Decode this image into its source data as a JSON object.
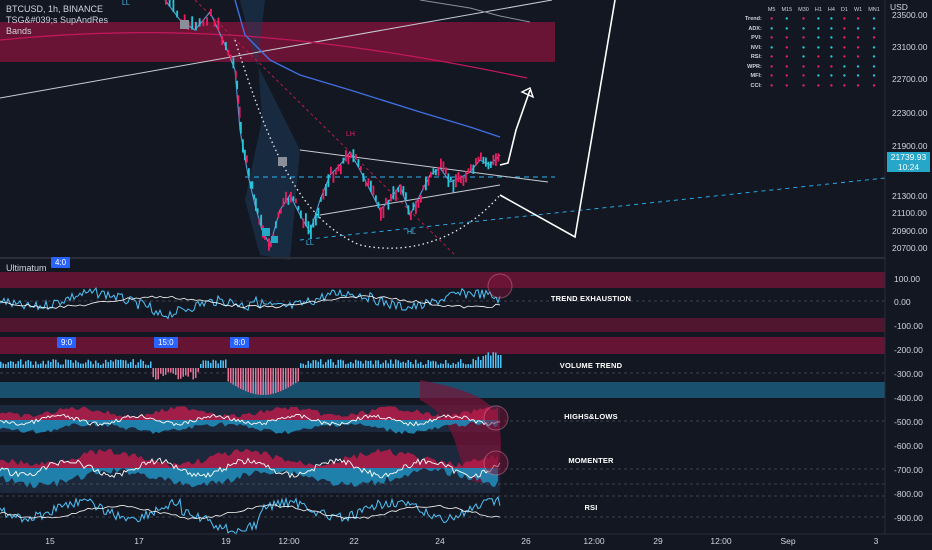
{
  "header": {
    "symbol_line": "BTCUSD, 1h, BINANCE",
    "indicator_line1": "TSG&#039;s SupAndRes",
    "indicator_line2": "Bands",
    "ll_top": "LL"
  },
  "price_axis": {
    "currency": "USD",
    "labels": [
      "23500.00",
      "23100.00",
      "22700.00",
      "22300.00",
      "21900.00",
      "21300.00",
      "21100.00",
      "20900.00",
      "20700.00"
    ],
    "badge_price": "21739.93",
    "badge_time": "10:24"
  },
  "indicator_axis": {
    "labels": [
      "100.00",
      "0.00",
      "-100.00",
      "-200.00",
      "-300.00",
      "-400.00",
      "-500.00",
      "-600.00",
      "-700.00",
      "-800.00",
      "-900.00"
    ]
  },
  "time_axis": {
    "labels": [
      "15",
      "17",
      "19",
      "12:00",
      "22",
      "24",
      "26",
      "12:00",
      "29",
      "12:00",
      "Sep",
      "3"
    ]
  },
  "annotations": {
    "lh": "LH",
    "hl": "HL",
    "ll_bottom": "LL"
  },
  "indicator_pane": {
    "name": "Ultimatum",
    "top_marker": "4:0",
    "markers": [
      "9:0",
      "15:0",
      "8:0"
    ],
    "sections": [
      "TREND EXHAUSTION",
      "VOLUME TREND",
      "HIGHS&LOWS",
      "MOMENTER",
      "RSI"
    ]
  },
  "mtf_table": {
    "columns": [
      "M5",
      "M15",
      "M30",
      "H1",
      "H4",
      "D1",
      "W1",
      "MN1"
    ],
    "rows": [
      {
        "label": "Trend:",
        "cells": [
          "r",
          "g",
          "r",
          "g",
          "g",
          "r",
          "r",
          "g"
        ]
      },
      {
        "label": "ADX:",
        "cells": [
          "g",
          "g",
          "g",
          "g",
          "g",
          "r",
          "g",
          "g"
        ]
      },
      {
        "label": "PVI:",
        "cells": [
          "r",
          "r",
          "r",
          "g",
          "g",
          "r",
          "r",
          "r"
        ]
      },
      {
        "label": "NVI:",
        "cells": [
          "g",
          "r",
          "g",
          "g",
          "g",
          "r",
          "r",
          "g"
        ]
      },
      {
        "label": "RSI:",
        "cells": [
          "r",
          "r",
          "g",
          "r",
          "g",
          "r",
          "r",
          "g"
        ]
      },
      {
        "label": "WPR:",
        "cells": [
          "r",
          "r",
          "r",
          "r",
          "r",
          "g",
          "g",
          "g"
        ]
      },
      {
        "label": "MFI:",
        "cells": [
          "r",
          "r",
          "r",
          "g",
          "g",
          "g",
          "g",
          "g"
        ]
      },
      {
        "label": "CCI:",
        "cells": [
          "r",
          "r",
          "r",
          "r",
          "r",
          "r",
          "r",
          "r"
        ]
      }
    ]
  },
  "colors": {
    "background": "#131722",
    "bull": "#26c6da",
    "bear": "#e91e63",
    "band": "#b71c4a",
    "accent": "#2962ff"
  }
}
